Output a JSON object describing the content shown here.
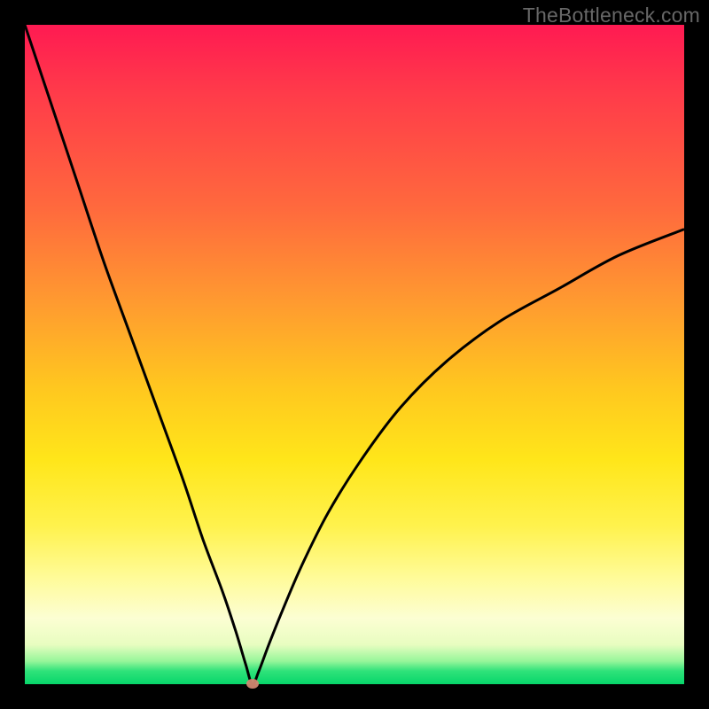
{
  "watermark": "TheBottleneck.com",
  "colors": {
    "curve": "#000000",
    "vertex_dot": "#cf8771",
    "frame": "#000000"
  },
  "chart_data": {
    "type": "line",
    "title": "",
    "xlabel": "",
    "ylabel": "",
    "xlim": [
      0,
      100
    ],
    "ylim": [
      0,
      100
    ],
    "vertex": {
      "x": 34.5,
      "y": 0
    },
    "series": [
      {
        "name": "curve",
        "x": [
          0,
          4,
          8,
          12,
          16,
          20,
          24,
          27,
          30,
          32,
          33.5,
          34.5,
          35.5,
          37,
          39,
          42,
          46,
          51,
          57,
          64,
          72,
          81,
          90,
          100
        ],
        "values": [
          100,
          88,
          76,
          64,
          53,
          42,
          31,
          22,
          14,
          8,
          3,
          0,
          2,
          6,
          11,
          18,
          26,
          34,
          42,
          49,
          55,
          60,
          65,
          69
        ]
      }
    ],
    "annotations": [
      {
        "type": "dot",
        "x": 34.5,
        "y": 0,
        "color": "#cf8771"
      }
    ]
  }
}
